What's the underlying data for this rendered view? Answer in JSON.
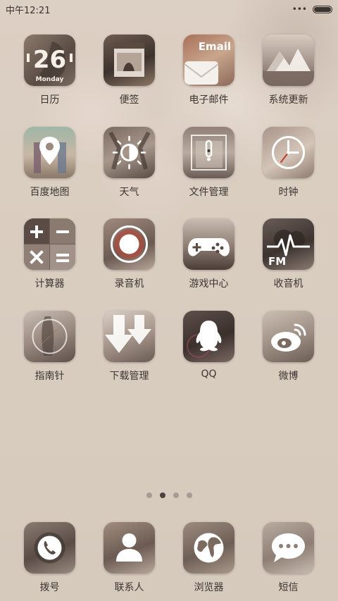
{
  "status": {
    "time": "中午12:21",
    "battery_level": 1.0
  },
  "icons": {
    "calendar": {
      "day": "26",
      "weekday": "Monday"
    },
    "email": {
      "text": "Email"
    },
    "radio": {
      "text": "FM"
    }
  },
  "apps": [
    {
      "label": "日历",
      "icon": "calendar-icon"
    },
    {
      "label": "便签",
      "icon": "notes-icon"
    },
    {
      "label": "电子邮件",
      "icon": "email-icon"
    },
    {
      "label": "系统更新",
      "icon": "update-icon"
    },
    {
      "label": "百度地图",
      "icon": "map-pin-icon"
    },
    {
      "label": "天气",
      "icon": "sun-icon"
    },
    {
      "label": "文件管理",
      "icon": "file-icon"
    },
    {
      "label": "时钟",
      "icon": "clock-icon"
    },
    {
      "label": "计算器",
      "icon": "calculator-icon"
    },
    {
      "label": "录音机",
      "icon": "record-icon"
    },
    {
      "label": "游戏中心",
      "icon": "gamepad-icon"
    },
    {
      "label": "收音机",
      "icon": "radio-icon"
    },
    {
      "label": "指南针",
      "icon": "compass-icon"
    },
    {
      "label": "下载管理",
      "icon": "download-icon"
    },
    {
      "label": "QQ",
      "icon": "qq-penguin-icon"
    },
    {
      "label": "微博",
      "icon": "weibo-icon"
    }
  ],
  "pager": {
    "pages": 4,
    "active_index": 1
  },
  "dock": [
    {
      "label": "拨号",
      "icon": "phone-icon"
    },
    {
      "label": "联系人",
      "icon": "contact-icon"
    },
    {
      "label": "浏览器",
      "icon": "globe-icon"
    },
    {
      "label": "短信",
      "icon": "message-icon"
    }
  ]
}
